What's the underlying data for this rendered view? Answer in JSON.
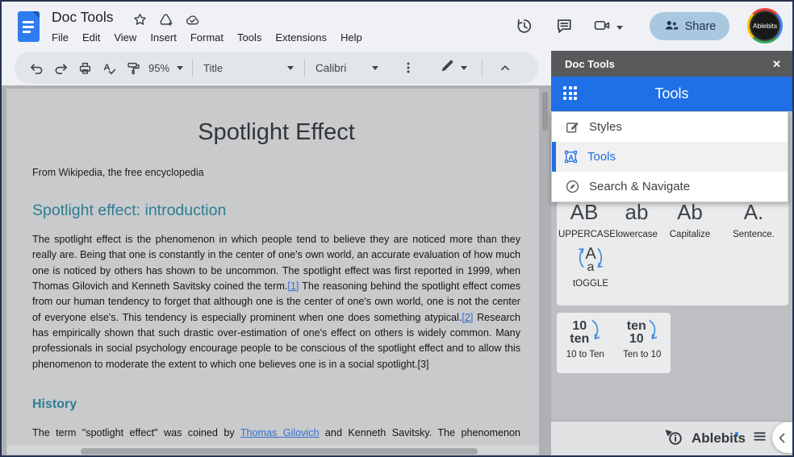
{
  "topbar": {
    "doc_title": "Doc Tools",
    "menu": [
      "File",
      "Edit",
      "View",
      "Insert",
      "Format",
      "Tools",
      "Extensions",
      "Help"
    ],
    "share_label": "Share",
    "avatar_label": "Ablebits"
  },
  "toolbar": {
    "zoom_value": "95%",
    "style_value": "Title",
    "font_value": "Calibri"
  },
  "document": {
    "title": "Spotlight Effect",
    "byline": "From Wikipedia, the free encyclopedia",
    "intro_heading": "Spotlight effect: introduction",
    "intro_parts": [
      {
        "text": "The spotlight effect is the phenomenon in which people tend to believe they are noticed more than they really are. Being that one is constantly in the center of one's own world, an accurate evaluation of how much one is noticed by others has shown to be uncommon. The spotlight effect was first reported in 1999, when Thomas Gilovich and Kenneth Savitsky coined the term.",
        "link": false
      },
      {
        "text": "[1]",
        "link": true
      },
      {
        "text": " The reasoning behind the spotlight effect comes from our human tendency to forget that although one is the center of one's own world, one is not the center of everyone else's. This tendency is especially prominent when one does something atypical.",
        "link": false
      },
      {
        "text": "[2]",
        "link": true
      },
      {
        "text": " Research has empirically shown that such drastic over-estimation of one's effect on others is widely common. Many professionals in social psychology encourage people to be conscious of the spotlight effect and to allow this phenomenon to moderate the extent to which one believes one is in a social spotlight.[3]",
        "link": false
      }
    ],
    "history_heading": "History",
    "history_parts": [
      {
        "text": "The term \"spotlight effect\" was coined by ",
        "link": false
      },
      {
        "text": "Thomas Gilovich",
        "link": true
      },
      {
        "text": " and Kenneth Savitsky. The phenomenon",
        "link": false
      }
    ]
  },
  "sidebar": {
    "header_title": "Doc Tools",
    "close_glyph": "✕",
    "panel_title": "Tools",
    "menu_items": [
      {
        "label": "Styles"
      },
      {
        "label": "Tools",
        "active": true
      },
      {
        "label": "Search & Navigate"
      }
    ],
    "case_buttons": [
      {
        "glyph": "AB",
        "label": "UPPERCASE"
      },
      {
        "glyph": "ab",
        "label": "lowercase"
      },
      {
        "glyph": "Ab",
        "label": "Capitalize"
      },
      {
        "glyph": "A.",
        "label": "Sentence."
      }
    ],
    "toggle_button": {
      "top": "A",
      "bottom": "a",
      "label": "tOGGLE"
    },
    "number_buttons": [
      {
        "top": "10",
        "bottom": "ten",
        "label": "10 to Ten"
      },
      {
        "top": "ten",
        "bottom": "10",
        "label": "Ten to 10"
      }
    ],
    "footer_brand": "Ablebits"
  },
  "colors": {
    "accent_blue": "#1f6fe6",
    "sidebar_header_gray": "#58595b",
    "teal_heading": "#2e7d92",
    "link_blue": "#3470cf",
    "share_pill_bg": "#a9c7df",
    "share_pill_text": "#20344b",
    "arrow_blue": "#4a90d9"
  }
}
